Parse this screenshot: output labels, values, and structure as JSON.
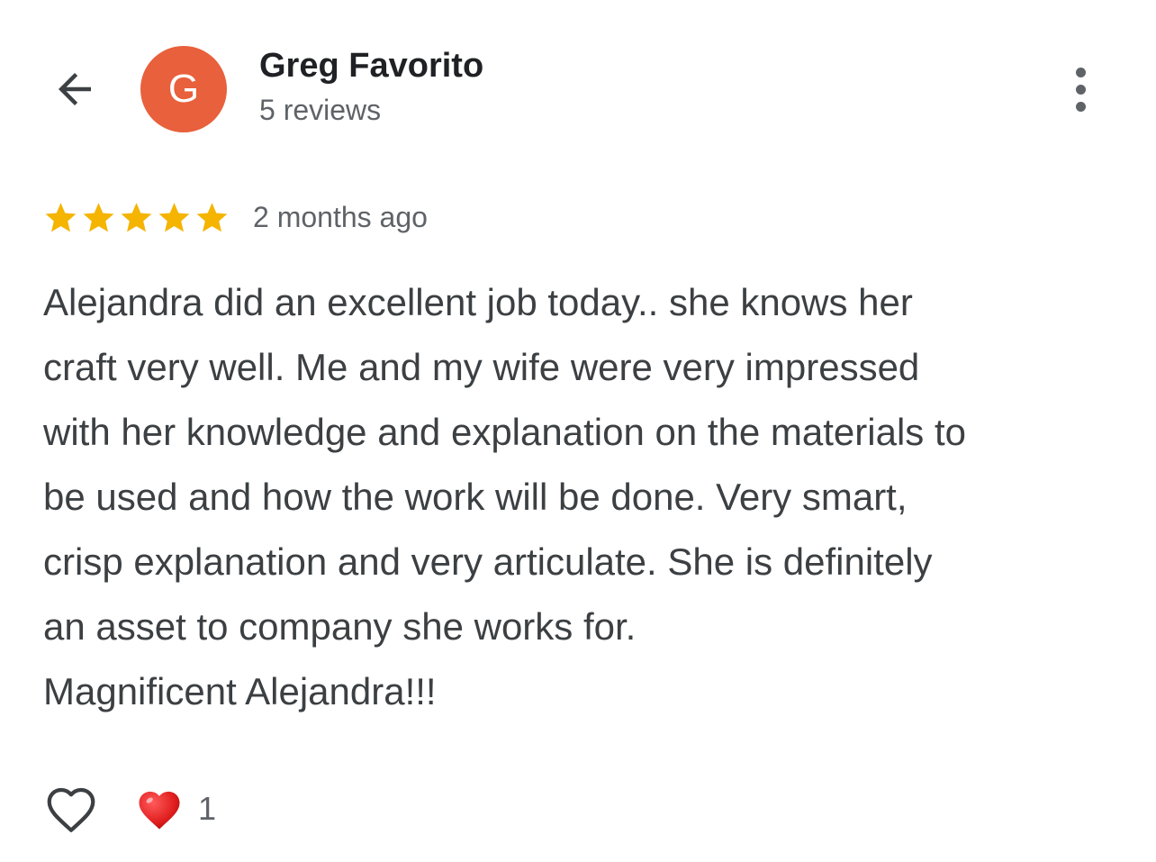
{
  "header": {
    "back_icon": "arrow-left-icon",
    "avatar_letter": "G",
    "avatar_color": "#e8603c",
    "reviewer_name": "Greg Favorito",
    "review_count": "5 reviews",
    "more_icon": "more-vertical-icon"
  },
  "review": {
    "rating": 5,
    "max_rating": 5,
    "star_color": "#f4b400",
    "date": "2 months ago",
    "text_lines": [
      "Alejandra did an excellent job today.. she knows her",
      "craft very well. Me and my wife were very impressed",
      "with her knowledge and explanation on the materials to",
      "be used and how the work will be done. Very smart,",
      "crisp explanation and very articulate. She is definitely",
      "an asset to company she works for.",
      "Magnificent Alejandra!!!"
    ]
  },
  "actions": {
    "like_icon": "heart-outline-icon",
    "reaction_icon": "red-heart-icon",
    "reaction_count": "1"
  }
}
